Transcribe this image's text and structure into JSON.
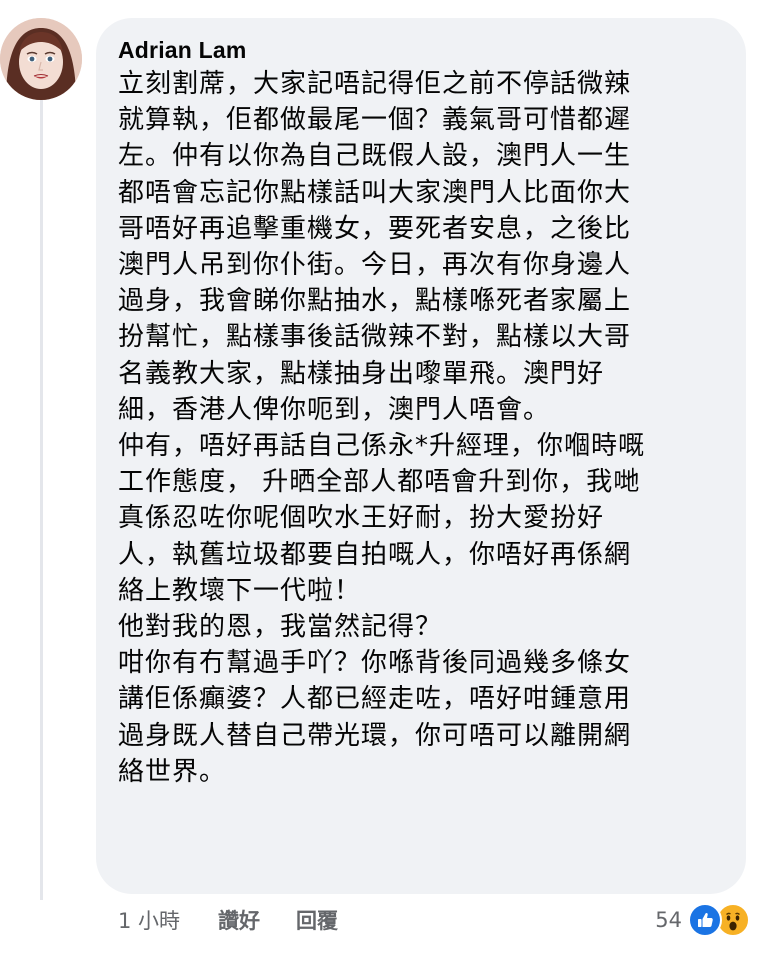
{
  "comment": {
    "author": "Adrian Lam",
    "lines": [
      "立刻割蓆，大家記唔記得佢之前不停話微辣",
      "就算執，佢都做最尾一個？義氣哥可惜都遲",
      "左。仲有以你為自己既假人設，澳門人一生",
      "都唔會忘記你點樣話叫大家澳門人比面你大",
      "哥唔好再追擊重機女，要死者安息，之後比",
      "澳門人吊到你仆街。今日，再次有你身邊人",
      "過身，我會睇你點抽水，點樣喺死者家屬上",
      "扮幫忙，點樣事後話微辣不對，點樣以大哥",
      "名義教大家，點樣抽身出嚟單飛。澳門好",
      "細，香港人俾你呃到，澳門人唔會。",
      "仲有，唔好再話自己係永*升經理，你嗰時嘅",
      "工作態度， 升晒全部人都唔會升到你，我哋",
      "真係忍咗你呢個吹水王好耐，扮大愛扮好",
      "人，執舊垃圾都要自拍嘅人，你唔好再係網",
      "絡上教壞下一代啦！",
      "他對我的恩，我當然記得？",
      "咁你有冇幫過手吖？你喺背後同過幾多條女",
      "講佢係癲婆？人都已經走咗，唔好咁鍾意用",
      "過身既人替自己帶光環，你可唔可以離開網",
      "絡世界。"
    ]
  },
  "actions": {
    "time": "1 小時",
    "like": "讚好",
    "reply": "回覆"
  },
  "reactions": {
    "count": "54",
    "icons": [
      "like-icon",
      "wow-icon"
    ],
    "like_color": "#1b74e4",
    "wow_color": "#f7b125"
  }
}
